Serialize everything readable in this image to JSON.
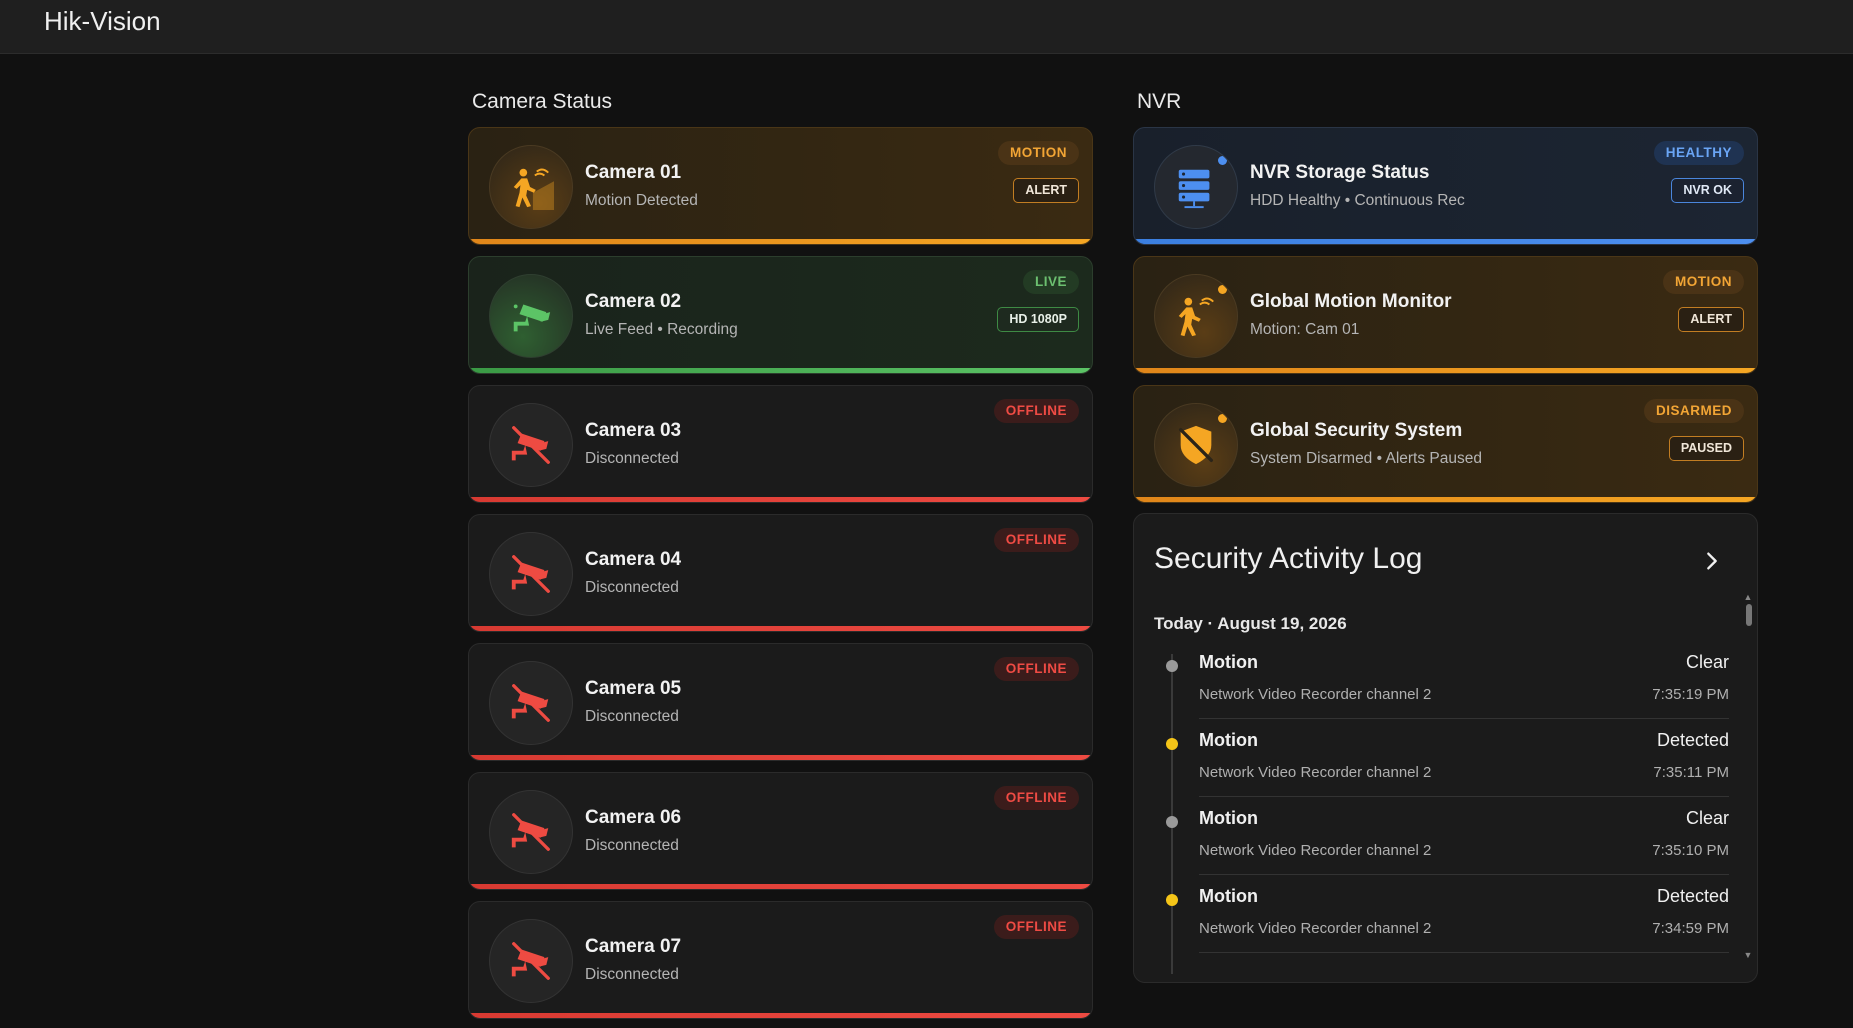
{
  "app": {
    "title": "Hik-Vision"
  },
  "sections": {
    "cameras": "Camera Status",
    "nvr": "NVR"
  },
  "cameras": [
    {
      "name": "Camera 01",
      "status": "Motion Detected",
      "badge": "MOTION",
      "tag": "ALERT",
      "theme": "orange",
      "icon": "motion-person-icon"
    },
    {
      "name": "Camera 02",
      "status": "Live Feed • Recording",
      "badge": "LIVE",
      "tag": "HD 1080P",
      "theme": "green",
      "icon": "cctv-camera-icon"
    },
    {
      "name": "Camera 03",
      "status": "Disconnected",
      "badge": "OFFLINE",
      "theme": "red",
      "icon": "camera-off-icon"
    },
    {
      "name": "Camera 04",
      "status": "Disconnected",
      "badge": "OFFLINE",
      "theme": "red",
      "icon": "camera-off-icon"
    },
    {
      "name": "Camera 05",
      "status": "Disconnected",
      "badge": "OFFLINE",
      "theme": "red",
      "icon": "camera-off-icon"
    },
    {
      "name": "Camera 06",
      "status": "Disconnected",
      "badge": "OFFLINE",
      "theme": "red",
      "icon": "camera-off-icon"
    },
    {
      "name": "Camera 07",
      "status": "Disconnected",
      "badge": "OFFLINE",
      "theme": "red",
      "icon": "camera-off-icon"
    }
  ],
  "nvr": [
    {
      "name": "NVR Storage Status",
      "status": "HDD Healthy • Continuous Rec",
      "badge": "HEALTHY",
      "tag": "NVR OK",
      "theme": "blue",
      "icon": "server-icon"
    },
    {
      "name": "Global Motion Monitor",
      "status": "Motion: Cam 01",
      "badge": "MOTION",
      "tag": "ALERT",
      "theme": "orange",
      "icon": "motion-person-icon"
    },
    {
      "name": "Global Security System",
      "status": "System Disarmed • Alerts Paused",
      "badge": "DISARMED",
      "tag": "PAUSED",
      "theme": "orange",
      "icon": "shield-off-icon"
    }
  ],
  "log": {
    "title": "Security Activity Log",
    "date": "Today · August 19, 2026",
    "entries": [
      {
        "type": "Motion",
        "state": "Clear",
        "source": "Network Video Recorder channel 2",
        "time": "7:35:19 PM",
        "dot_color": "#9a9a9a"
      },
      {
        "type": "Motion",
        "state": "Detected",
        "source": "Network Video Recorder channel 2",
        "time": "7:35:11 PM",
        "dot_color": "#f5c518"
      },
      {
        "type": "Motion",
        "state": "Clear",
        "source": "Network Video Recorder channel 2",
        "time": "7:35:10 PM",
        "dot_color": "#9a9a9a"
      },
      {
        "type": "Motion",
        "state": "Detected",
        "source": "Network Video Recorder channel 2",
        "time": "7:34:59 PM",
        "dot_color": "#f5c518"
      }
    ]
  },
  "colors": {
    "orange": "#f5a623",
    "green": "#5cc466",
    "red": "#ee4b42",
    "blue": "#4d8ff0"
  }
}
